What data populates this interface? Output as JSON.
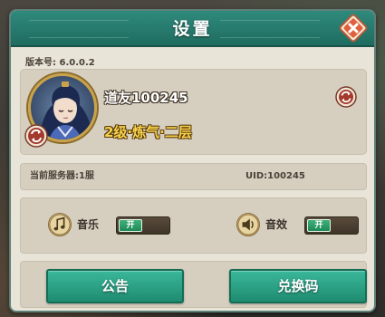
{
  "dialog": {
    "title": "设置",
    "version": "版本号: 6.0.0.2"
  },
  "profile": {
    "username": "道友100245",
    "rank": "2级·炼气·二层"
  },
  "info": {
    "server": "当前服务器:1服",
    "uid": "UID:100245"
  },
  "audio": {
    "music_label": "音乐",
    "music_toggle": "开",
    "sfx_label": "音效",
    "sfx_toggle": "开"
  },
  "buttons": {
    "notice": "公告",
    "redeem": "兑换码"
  },
  "colors": {
    "accent": "#2f8a7c",
    "button": "#2aa486",
    "panel": "#e9e4d8"
  }
}
